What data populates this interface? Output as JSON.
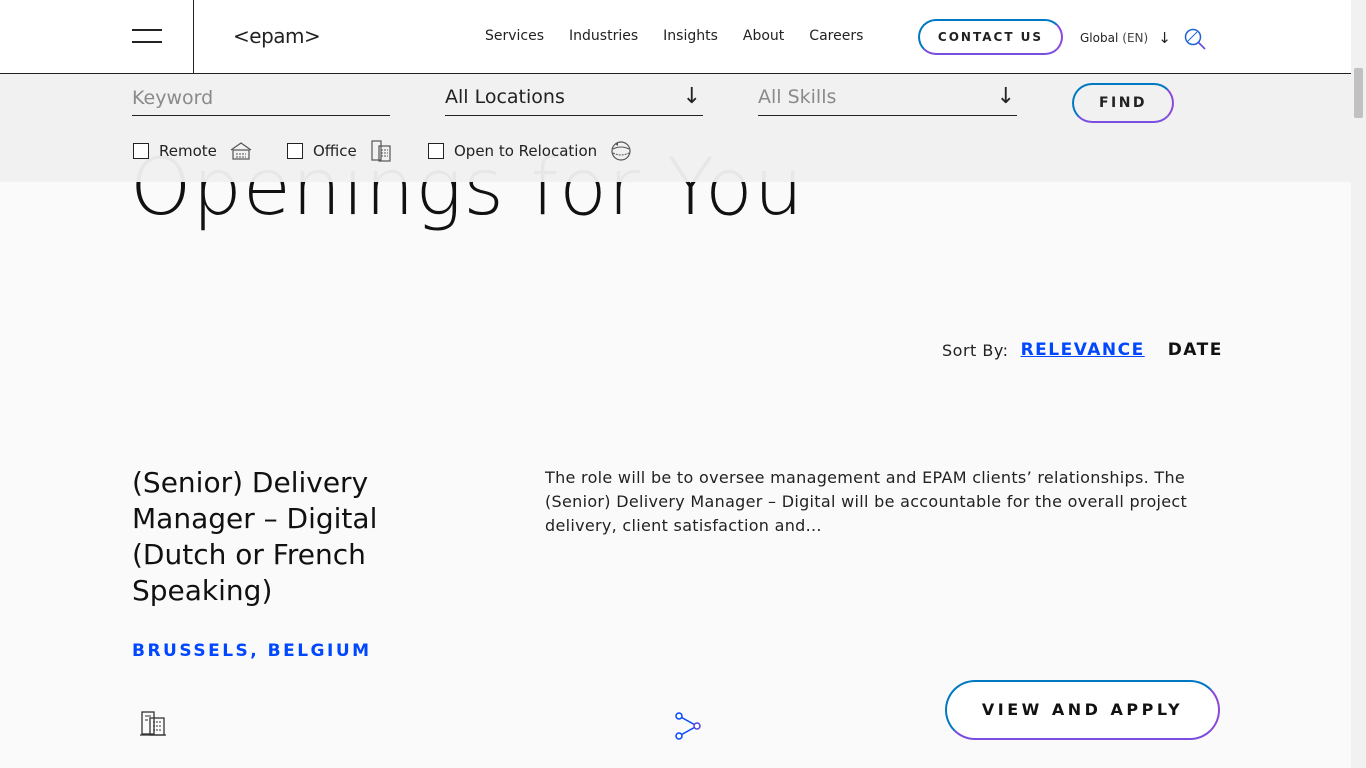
{
  "header": {
    "logo": "<epam>",
    "nav": [
      "Services",
      "Industries",
      "Insights",
      "About",
      "Careers"
    ],
    "contact_label": "CONTACT US",
    "region": "Global",
    "language": "(EN)"
  },
  "filters": {
    "keyword_placeholder": "Keyword",
    "location_value": "All Locations",
    "skills_value": "All Skills",
    "find_label": "FIND",
    "checkboxes": [
      "Remote",
      "Office",
      "Open to Relocation"
    ]
  },
  "main": {
    "heading": "Openings for You",
    "sort_label": "Sort By:",
    "sort_relevance": "RELEVANCE",
    "sort_date": "DATE"
  },
  "job": {
    "title": "(Senior) Delivery Manager – Digital (Dutch or French Speaking)",
    "location": "BRUSSELS, BELGIUM",
    "description": "The role will be to oversee management and EPAM clients’ relationships. The (Senior) Delivery Manager – Digital will be accountable for the overall project delivery, client satisfaction and...",
    "apply_label": "VIEW AND APPLY"
  },
  "colors": {
    "accent_blue": "#0047ff",
    "gradient_start": "#0078c2",
    "gradient_end": "#8b49d9"
  },
  "icons": [
    "menu-icon",
    "search-icon",
    "chevron-down-icon",
    "remote-house-icon",
    "office-building-icon",
    "relocation-icon",
    "share-icon"
  ]
}
